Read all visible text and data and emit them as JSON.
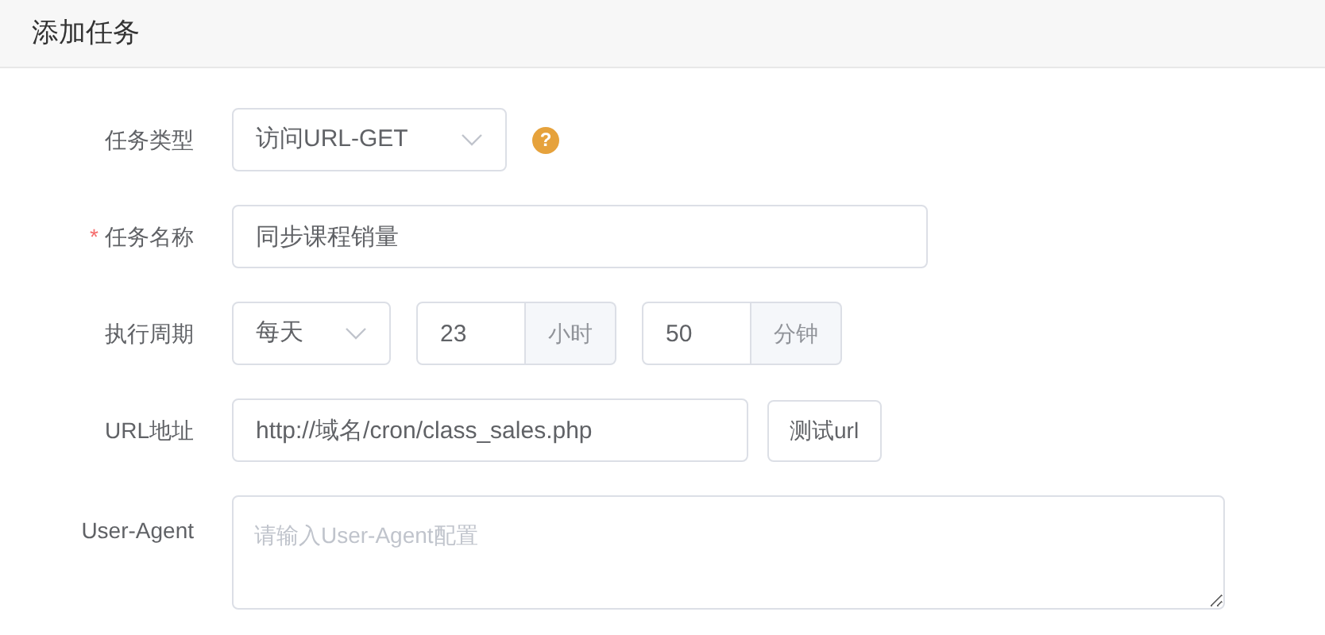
{
  "header": {
    "title": "添加任务"
  },
  "required_mark": "*",
  "fields": [
    {
      "kind": "select",
      "label": "任务类型",
      "required": false,
      "value": "访问URL-GET",
      "help": "?"
    },
    {
      "kind": "text",
      "label": "任务名称",
      "required": true,
      "value": "同步课程销量"
    },
    {
      "kind": "period",
      "label": "执行周期",
      "required": false,
      "select": "每天",
      "hour": "23",
      "hour_unit": "小时",
      "minute": "50",
      "minute_unit": "分钟"
    },
    {
      "kind": "url",
      "label": "URL地址",
      "required": false,
      "value": "http://域名/cron/class_sales.php",
      "button": "测试url"
    },
    {
      "kind": "textarea",
      "label": "User-Agent",
      "required": false,
      "placeholder": "请输入User-Agent配置"
    }
  ]
}
